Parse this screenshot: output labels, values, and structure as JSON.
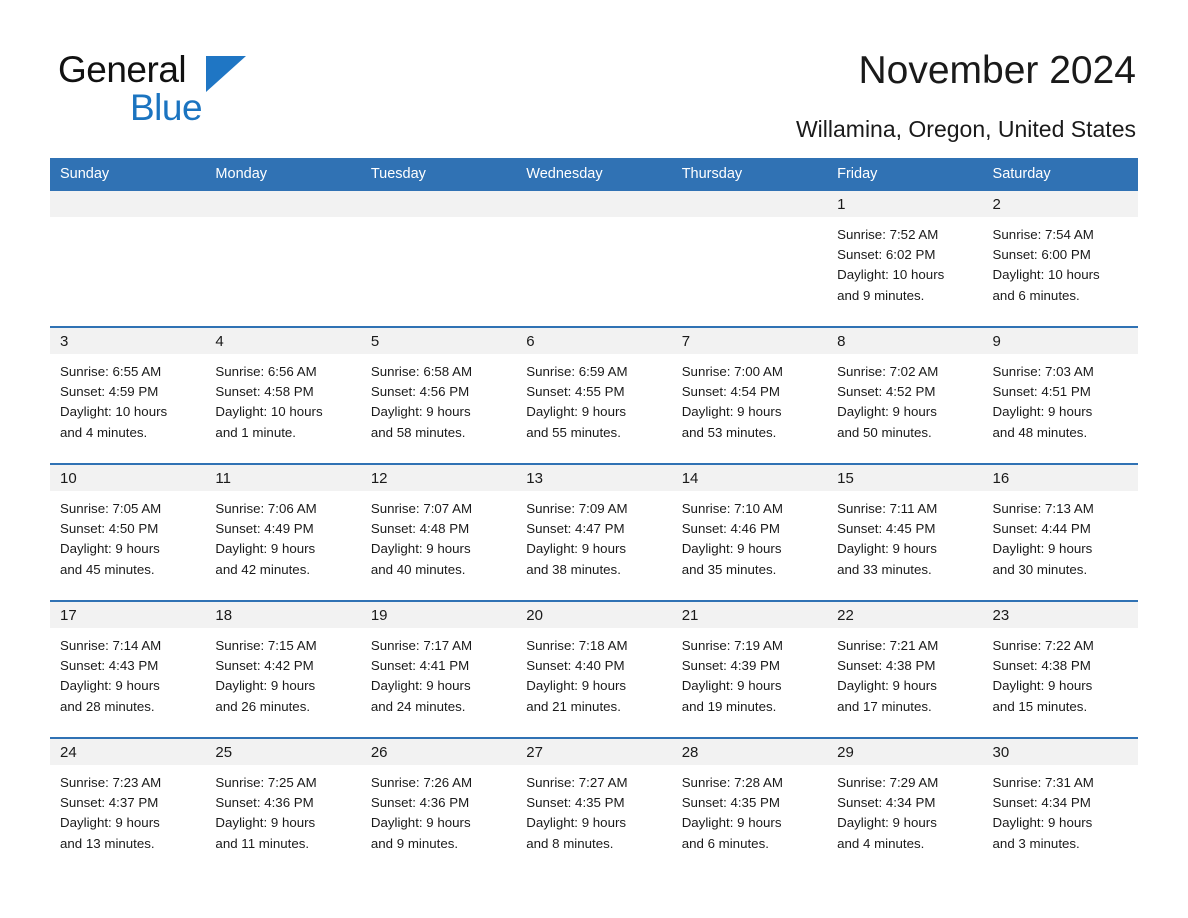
{
  "branding": {
    "logo_text_top": "General",
    "logo_text_bottom": "Blue",
    "accent_color": "#1b74c0"
  },
  "header": {
    "title": "November 2024",
    "subtitle": "Willamina, Oregon, United States",
    "header_bg_color": "#3072b4",
    "daynum_bg_color": "#f2f2f2"
  },
  "weekday_headers": [
    "Sunday",
    "Monday",
    "Tuesday",
    "Wednesday",
    "Thursday",
    "Friday",
    "Saturday"
  ],
  "weeks": [
    {
      "days": [
        {
          "day": "",
          "empty": true,
          "sunrise": "",
          "sunset": "",
          "daylight_line1": "",
          "daylight_line2": ""
        },
        {
          "day": "",
          "empty": true,
          "sunrise": "",
          "sunset": "",
          "daylight_line1": "",
          "daylight_line2": ""
        },
        {
          "day": "",
          "empty": true,
          "sunrise": "",
          "sunset": "",
          "daylight_line1": "",
          "daylight_line2": ""
        },
        {
          "day": "",
          "empty": true,
          "sunrise": "",
          "sunset": "",
          "daylight_line1": "",
          "daylight_line2": ""
        },
        {
          "day": "",
          "empty": true,
          "sunrise": "",
          "sunset": "",
          "daylight_line1": "",
          "daylight_line2": ""
        },
        {
          "day": "1",
          "empty": false,
          "sunrise": "Sunrise: 7:52 AM",
          "sunset": "Sunset: 6:02 PM",
          "daylight_line1": "Daylight: 10 hours",
          "daylight_line2": "and 9 minutes."
        },
        {
          "day": "2",
          "empty": false,
          "sunrise": "Sunrise: 7:54 AM",
          "sunset": "Sunset: 6:00 PM",
          "daylight_line1": "Daylight: 10 hours",
          "daylight_line2": "and 6 minutes."
        }
      ]
    },
    {
      "days": [
        {
          "day": "3",
          "empty": false,
          "sunrise": "Sunrise: 6:55 AM",
          "sunset": "Sunset: 4:59 PM",
          "daylight_line1": "Daylight: 10 hours",
          "daylight_line2": "and 4 minutes."
        },
        {
          "day": "4",
          "empty": false,
          "sunrise": "Sunrise: 6:56 AM",
          "sunset": "Sunset: 4:58 PM",
          "daylight_line1": "Daylight: 10 hours",
          "daylight_line2": "and 1 minute."
        },
        {
          "day": "5",
          "empty": false,
          "sunrise": "Sunrise: 6:58 AM",
          "sunset": "Sunset: 4:56 PM",
          "daylight_line1": "Daylight: 9 hours",
          "daylight_line2": "and 58 minutes."
        },
        {
          "day": "6",
          "empty": false,
          "sunrise": "Sunrise: 6:59 AM",
          "sunset": "Sunset: 4:55 PM",
          "daylight_line1": "Daylight: 9 hours",
          "daylight_line2": "and 55 minutes."
        },
        {
          "day": "7",
          "empty": false,
          "sunrise": "Sunrise: 7:00 AM",
          "sunset": "Sunset: 4:54 PM",
          "daylight_line1": "Daylight: 9 hours",
          "daylight_line2": "and 53 minutes."
        },
        {
          "day": "8",
          "empty": false,
          "sunrise": "Sunrise: 7:02 AM",
          "sunset": "Sunset: 4:52 PM",
          "daylight_line1": "Daylight: 9 hours",
          "daylight_line2": "and 50 minutes."
        },
        {
          "day": "9",
          "empty": false,
          "sunrise": "Sunrise: 7:03 AM",
          "sunset": "Sunset: 4:51 PM",
          "daylight_line1": "Daylight: 9 hours",
          "daylight_line2": "and 48 minutes."
        }
      ]
    },
    {
      "days": [
        {
          "day": "10",
          "empty": false,
          "sunrise": "Sunrise: 7:05 AM",
          "sunset": "Sunset: 4:50 PM",
          "daylight_line1": "Daylight: 9 hours",
          "daylight_line2": "and 45 minutes."
        },
        {
          "day": "11",
          "empty": false,
          "sunrise": "Sunrise: 7:06 AM",
          "sunset": "Sunset: 4:49 PM",
          "daylight_line1": "Daylight: 9 hours",
          "daylight_line2": "and 42 minutes."
        },
        {
          "day": "12",
          "empty": false,
          "sunrise": "Sunrise: 7:07 AM",
          "sunset": "Sunset: 4:48 PM",
          "daylight_line1": "Daylight: 9 hours",
          "daylight_line2": "and 40 minutes."
        },
        {
          "day": "13",
          "empty": false,
          "sunrise": "Sunrise: 7:09 AM",
          "sunset": "Sunset: 4:47 PM",
          "daylight_line1": "Daylight: 9 hours",
          "daylight_line2": "and 38 minutes."
        },
        {
          "day": "14",
          "empty": false,
          "sunrise": "Sunrise: 7:10 AM",
          "sunset": "Sunset: 4:46 PM",
          "daylight_line1": "Daylight: 9 hours",
          "daylight_line2": "and 35 minutes."
        },
        {
          "day": "15",
          "empty": false,
          "sunrise": "Sunrise: 7:11 AM",
          "sunset": "Sunset: 4:45 PM",
          "daylight_line1": "Daylight: 9 hours",
          "daylight_line2": "and 33 minutes."
        },
        {
          "day": "16",
          "empty": false,
          "sunrise": "Sunrise: 7:13 AM",
          "sunset": "Sunset: 4:44 PM",
          "daylight_line1": "Daylight: 9 hours",
          "daylight_line2": "and 30 minutes."
        }
      ]
    },
    {
      "days": [
        {
          "day": "17",
          "empty": false,
          "sunrise": "Sunrise: 7:14 AM",
          "sunset": "Sunset: 4:43 PM",
          "daylight_line1": "Daylight: 9 hours",
          "daylight_line2": "and 28 minutes."
        },
        {
          "day": "18",
          "empty": false,
          "sunrise": "Sunrise: 7:15 AM",
          "sunset": "Sunset: 4:42 PM",
          "daylight_line1": "Daylight: 9 hours",
          "daylight_line2": "and 26 minutes."
        },
        {
          "day": "19",
          "empty": false,
          "sunrise": "Sunrise: 7:17 AM",
          "sunset": "Sunset: 4:41 PM",
          "daylight_line1": "Daylight: 9 hours",
          "daylight_line2": "and 24 minutes."
        },
        {
          "day": "20",
          "empty": false,
          "sunrise": "Sunrise: 7:18 AM",
          "sunset": "Sunset: 4:40 PM",
          "daylight_line1": "Daylight: 9 hours",
          "daylight_line2": "and 21 minutes."
        },
        {
          "day": "21",
          "empty": false,
          "sunrise": "Sunrise: 7:19 AM",
          "sunset": "Sunset: 4:39 PM",
          "daylight_line1": "Daylight: 9 hours",
          "daylight_line2": "and 19 minutes."
        },
        {
          "day": "22",
          "empty": false,
          "sunrise": "Sunrise: 7:21 AM",
          "sunset": "Sunset: 4:38 PM",
          "daylight_line1": "Daylight: 9 hours",
          "daylight_line2": "and 17 minutes."
        },
        {
          "day": "23",
          "empty": false,
          "sunrise": "Sunrise: 7:22 AM",
          "sunset": "Sunset: 4:38 PM",
          "daylight_line1": "Daylight: 9 hours",
          "daylight_line2": "and 15 minutes."
        }
      ]
    },
    {
      "days": [
        {
          "day": "24",
          "empty": false,
          "sunrise": "Sunrise: 7:23 AM",
          "sunset": "Sunset: 4:37 PM",
          "daylight_line1": "Daylight: 9 hours",
          "daylight_line2": "and 13 minutes."
        },
        {
          "day": "25",
          "empty": false,
          "sunrise": "Sunrise: 7:25 AM",
          "sunset": "Sunset: 4:36 PM",
          "daylight_line1": "Daylight: 9 hours",
          "daylight_line2": "and 11 minutes."
        },
        {
          "day": "26",
          "empty": false,
          "sunrise": "Sunrise: 7:26 AM",
          "sunset": "Sunset: 4:36 PM",
          "daylight_line1": "Daylight: 9 hours",
          "daylight_line2": "and 9 minutes."
        },
        {
          "day": "27",
          "empty": false,
          "sunrise": "Sunrise: 7:27 AM",
          "sunset": "Sunset: 4:35 PM",
          "daylight_line1": "Daylight: 9 hours",
          "daylight_line2": "and 8 minutes."
        },
        {
          "day": "28",
          "empty": false,
          "sunrise": "Sunrise: 7:28 AM",
          "sunset": "Sunset: 4:35 PM",
          "daylight_line1": "Daylight: 9 hours",
          "daylight_line2": "and 6 minutes."
        },
        {
          "day": "29",
          "empty": false,
          "sunrise": "Sunrise: 7:29 AM",
          "sunset": "Sunset: 4:34 PM",
          "daylight_line1": "Daylight: 9 hours",
          "daylight_line2": "and 4 minutes."
        },
        {
          "day": "30",
          "empty": false,
          "sunrise": "Sunrise: 7:31 AM",
          "sunset": "Sunset: 4:34 PM",
          "daylight_line1": "Daylight: 9 hours",
          "daylight_line2": "and 3 minutes."
        }
      ]
    }
  ]
}
